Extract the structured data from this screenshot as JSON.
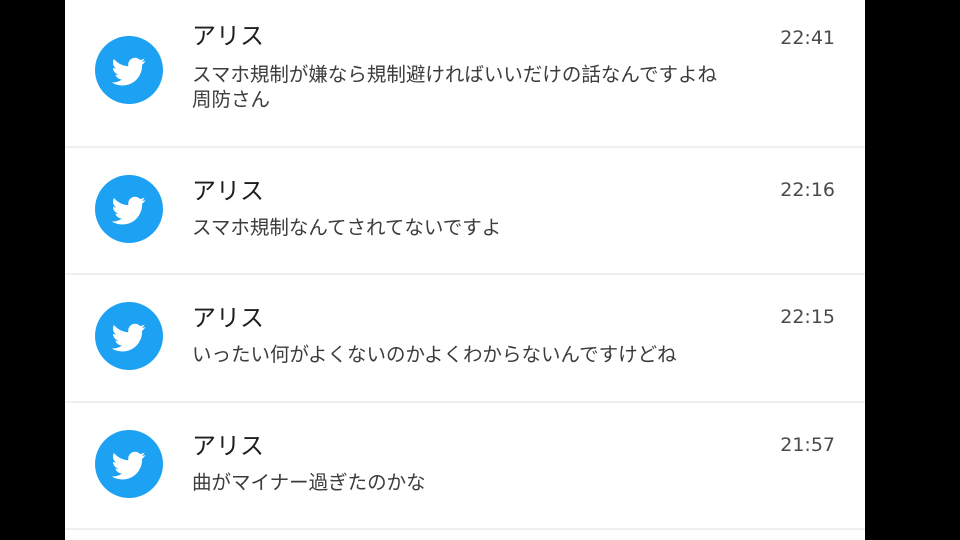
{
  "colors": {
    "twitter_blue": "#1da1f2",
    "background": "#000000",
    "card": "#ffffff",
    "divider": "#efefef"
  },
  "notifications": [
    {
      "icon": "twitter-bird-icon",
      "sender": "アリス",
      "time": "22:41",
      "message": "スマホ規制が嫌なら規制避ければいいだけの話なんですよね\n周防さん"
    },
    {
      "icon": "twitter-bird-icon",
      "sender": "アリス",
      "time": "22:16",
      "message": "スマホ規制なんてされてないですよ"
    },
    {
      "icon": "twitter-bird-icon",
      "sender": "アリス",
      "time": "22:15",
      "message": "いったい何がよくないのかよくわからないんですけどね"
    },
    {
      "icon": "twitter-bird-icon",
      "sender": "アリス",
      "time": "21:57",
      "message": "曲がマイナー過ぎたのかな"
    }
  ]
}
